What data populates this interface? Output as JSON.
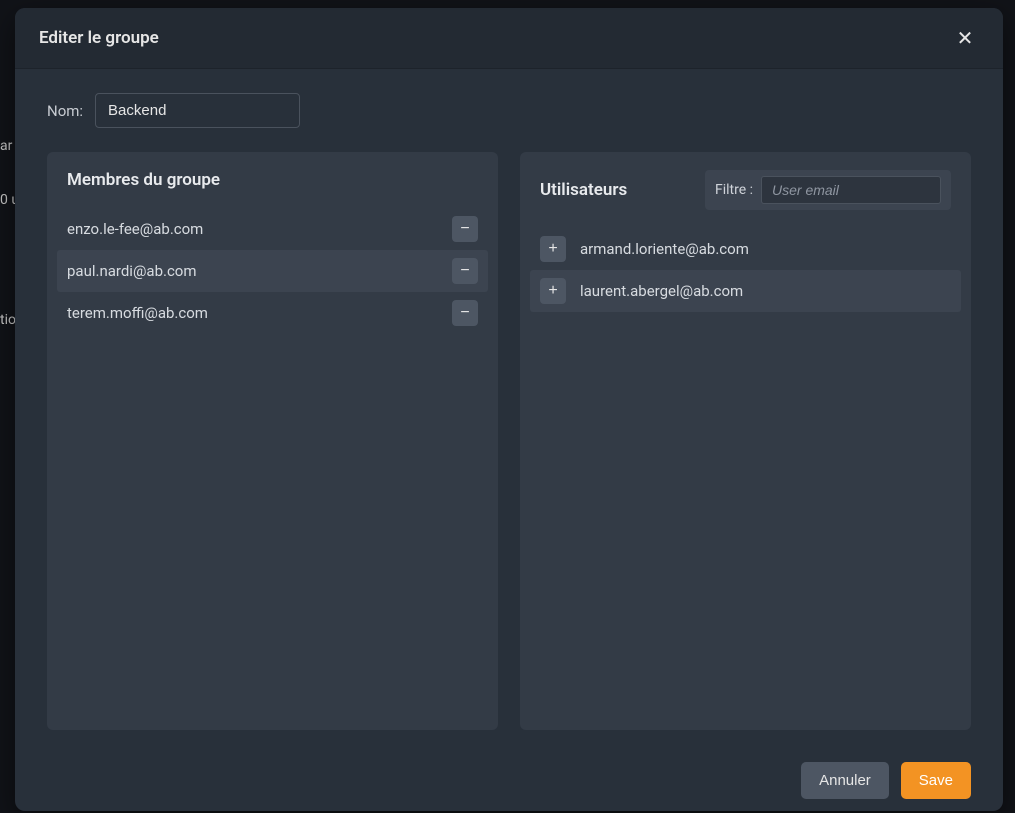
{
  "modal": {
    "title": "Editer le groupe",
    "name_label": "Nom:",
    "name_value": "Backend",
    "members_title": "Membres du groupe",
    "users_title": "Utilisateurs",
    "filter_label": "Filtre :",
    "filter_placeholder": "User email",
    "members": [
      {
        "email": "enzo.le-fee@ab.com"
      },
      {
        "email": "paul.nardi@ab.com"
      },
      {
        "email": "terem.moffi@ab.com"
      }
    ],
    "users": [
      {
        "email": "armand.loriente@ab.com"
      },
      {
        "email": "laurent.abergel@ab.com"
      }
    ],
    "cancel_label": "Annuler",
    "save_label": "Save"
  },
  "background": {
    "frag1": "ar",
    "frag2": "0 u",
    "frag3": "tio"
  }
}
